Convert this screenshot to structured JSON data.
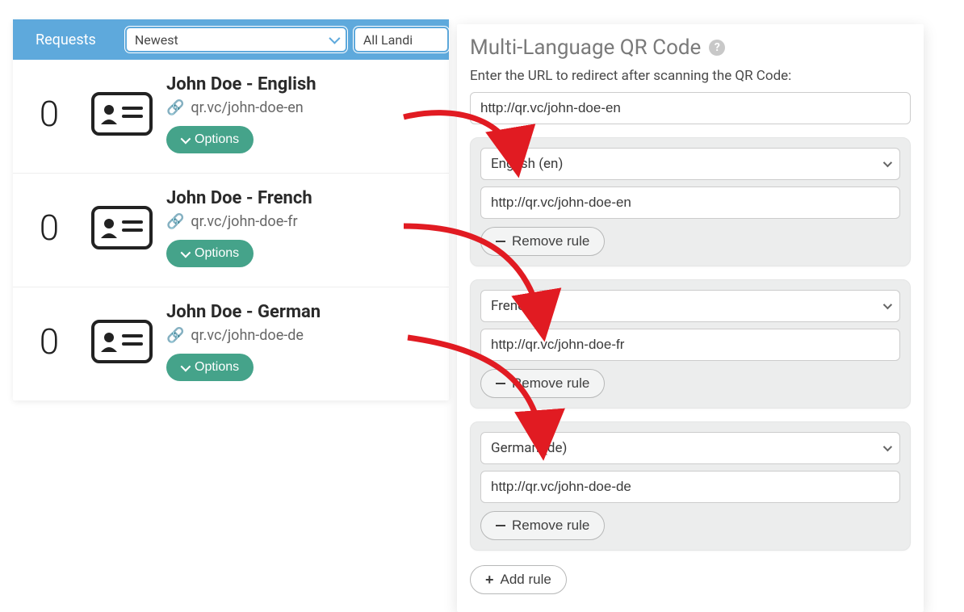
{
  "topBar": {
    "requests": "Requests",
    "sortSelect": "Newest",
    "filterSelect": "All Landi"
  },
  "items": [
    {
      "count": "0",
      "title": "John Doe - English",
      "url": "qr.vc/john-doe-en",
      "options": "Options"
    },
    {
      "count": "0",
      "title": "John Doe - French",
      "url": "qr.vc/john-doe-fr",
      "options": "Options"
    },
    {
      "count": "0",
      "title": "John Doe - German",
      "url": "qr.vc/john-doe-de",
      "options": "Options"
    }
  ],
  "rightPanel": {
    "title": "Multi-Language QR Code",
    "subtitle": "Enter the URL to redirect after scanning the QR Code:",
    "defaultUrl": "http://qr.vc/john-doe-en",
    "removeRule": "Remove rule",
    "addRule": "Add rule",
    "rules": [
      {
        "language": "English (en)",
        "url": "http://qr.vc/john-doe-en"
      },
      {
        "language": "French (fr)",
        "url": "http://qr.vc/john-doe-fr"
      },
      {
        "language": "German (de)",
        "url": "http://qr.vc/john-doe-de"
      }
    ]
  },
  "colors": {
    "headerBlue": "#5ea9dc",
    "optionsGreen": "#45a38a",
    "arrowRed": "#e11b22",
    "ruleCardBg": "#eceded"
  }
}
